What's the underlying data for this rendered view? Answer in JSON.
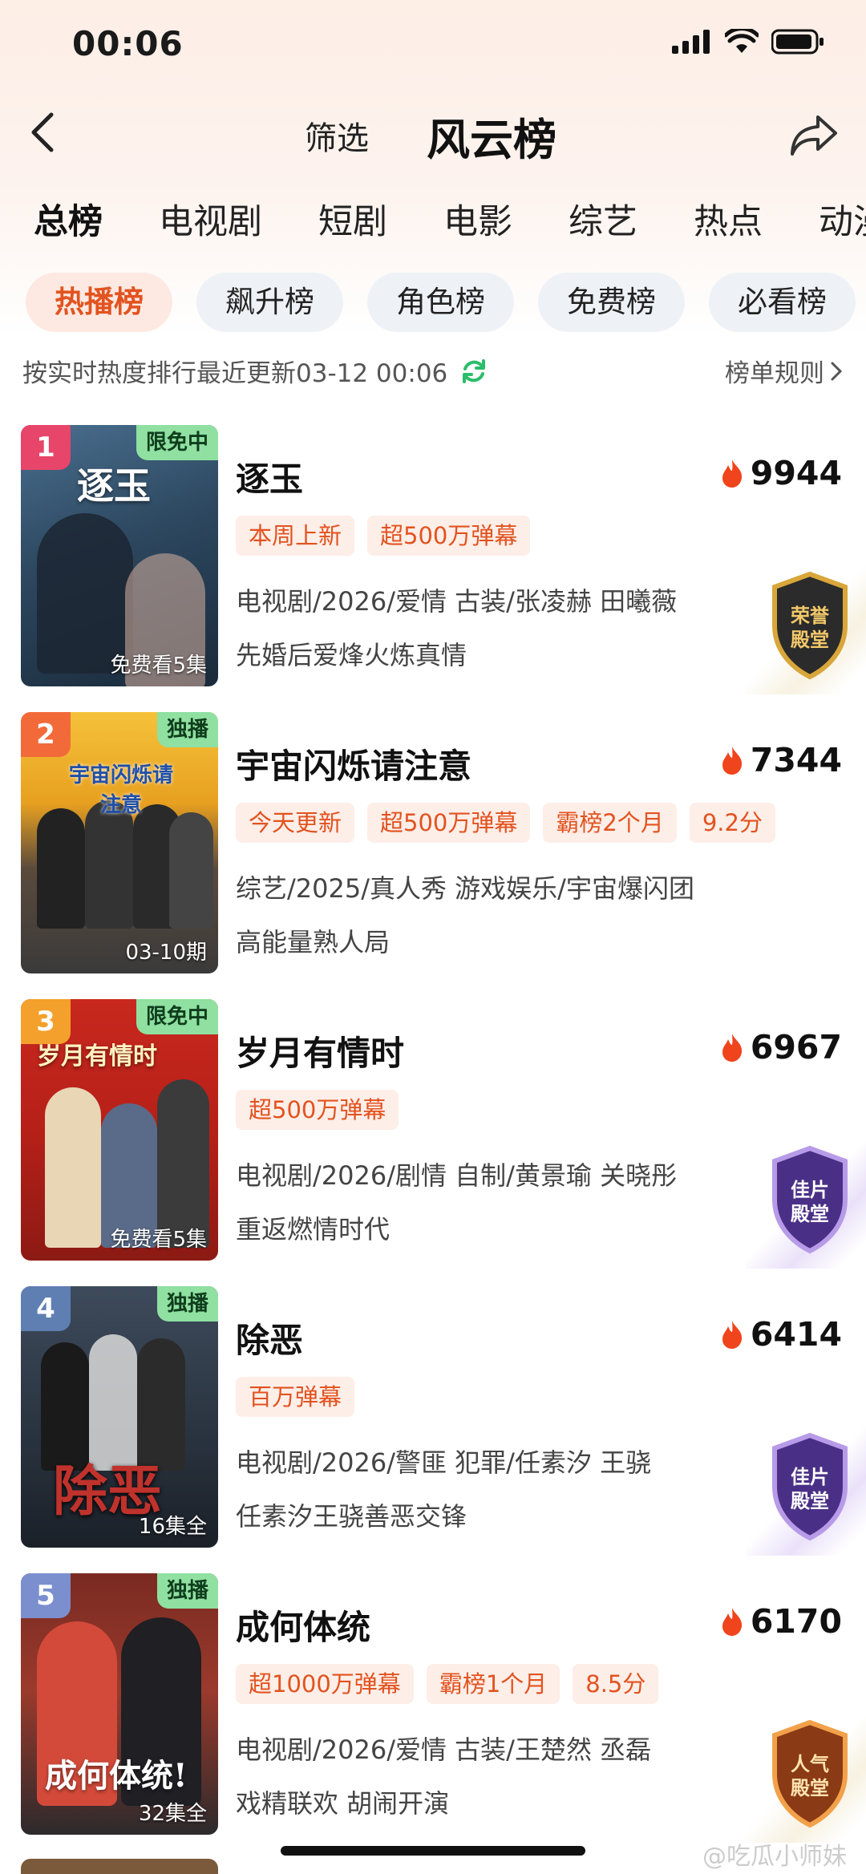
{
  "status_bar": {
    "time": "00:06"
  },
  "nav": {
    "filter_label": "筛选",
    "title": "风云榜"
  },
  "category_tabs": [
    "总榜",
    "电视剧",
    "短剧",
    "电影",
    "综艺",
    "热点",
    "动漫"
  ],
  "sub_tabs": [
    "热播榜",
    "飙升榜",
    "角色榜",
    "免费榜",
    "必看榜"
  ],
  "info": {
    "update_text": "按实时热度排行最近更新03-12 00:06",
    "rules_label": "榜单规则"
  },
  "items": [
    {
      "rank": "1",
      "badge": "限免中",
      "poster_text": "逐玉",
      "poster_footer": "免费看5集",
      "title": "逐玉",
      "heat": "9944",
      "tags": [
        "本周上新",
        "超500万弹幕"
      ],
      "meta": "电视剧/2026/爱情 古装/张凌赫 田曦薇",
      "desc": "先婚后爱烽火炼真情",
      "hall_text": [
        "荣誉",
        "殿堂"
      ]
    },
    {
      "rank": "2",
      "badge": "独播",
      "poster_text": "宇宙闪烁请注意",
      "poster_footer": "03-10期",
      "title": "宇宙闪烁请注意",
      "heat": "7344",
      "tags": [
        "今天更新",
        "超500万弹幕",
        "霸榜2个月",
        "9.2分"
      ],
      "meta": "综艺/2025/真人秀 游戏娱乐/宇宙爆闪团",
      "desc": "高能量熟人局"
    },
    {
      "rank": "3",
      "badge": "限免中",
      "poster_text": "岁月有情时",
      "poster_footer": "免费看5集",
      "title": "岁月有情时",
      "heat": "6967",
      "tags": [
        "超500万弹幕"
      ],
      "meta": "电视剧/2026/剧情 自制/黄景瑜 关晓彤",
      "desc": "重返燃情时代",
      "hall_text": [
        "佳片",
        "殿堂"
      ]
    },
    {
      "rank": "4",
      "badge": "独播",
      "poster_text": "除恶",
      "poster_footer": "16集全",
      "title": "除恶",
      "heat": "6414",
      "tags": [
        "百万弹幕"
      ],
      "meta": "电视剧/2026/警匪 犯罪/任素汐 王骁",
      "desc": "任素汐王骁善恶交锋",
      "hall_text": [
        "佳片",
        "殿堂"
      ]
    },
    {
      "rank": "5",
      "badge": "独播",
      "poster_text": "成何体统!",
      "poster_footer": "32集全",
      "title": "成何体统",
      "heat": "6170",
      "tags": [
        "超1000万弹幕",
        "霸榜1个月",
        "8.5分"
      ],
      "meta": "电视剧/2026/爱情 古装/王楚然 丞磊",
      "desc": "戏精联欢 胡闹开演",
      "hall_text": [
        "人气",
        "殿堂"
      ]
    }
  ],
  "watermark": "@吃瓜小师妹"
}
